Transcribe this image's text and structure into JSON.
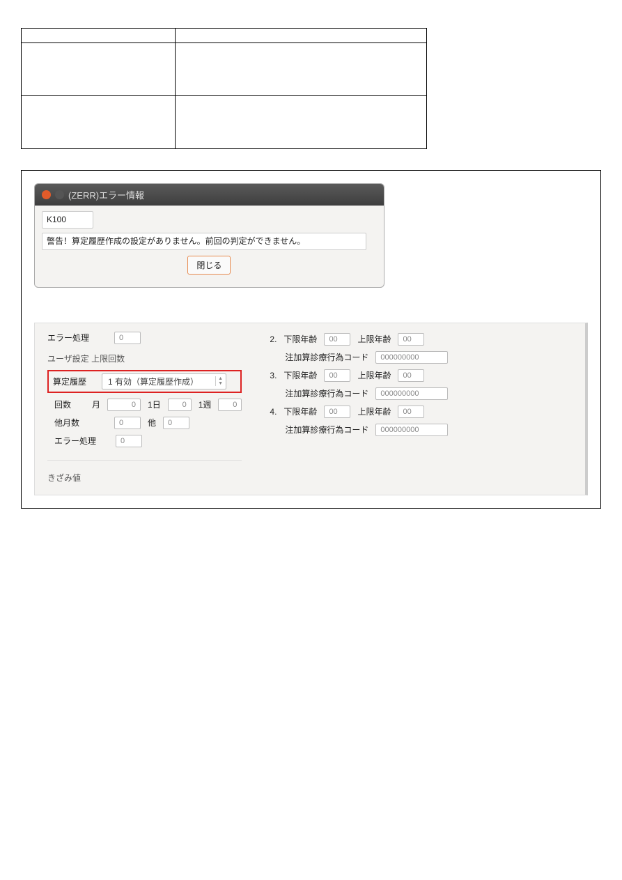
{
  "table": {
    "h1": "",
    "h2": "",
    "r1c1": "",
    "r1c2": "",
    "r2c1": "",
    "r2c2": ""
  },
  "dialog": {
    "title": "(ZERR)エラー情報",
    "code": "K100",
    "message": "警告！算定履歴作成の設定がありません。前回の判定ができません。",
    "close": "閉じる"
  },
  "panel": {
    "left": {
      "err_proc": "エラー処理",
      "err_proc_val": "0",
      "section": "ユーザ設定  上限回数",
      "santei": "算定履歴",
      "santei_val": "1 有効（算定履歴作成）",
      "kaisu": "回数",
      "tsuki": "月",
      "tsuki_v": "0",
      "ichiday": "1日",
      "ichiday_v": "0",
      "ichishuu": "1週",
      "ichishuu_v": "0",
      "tagetsu": "他月数",
      "tagetsu_v": "0",
      "ta": "他",
      "ta_v": "0",
      "err_proc2": "エラー処理",
      "err_proc2_v": "0",
      "kizami": "きざみ値"
    },
    "right": [
      {
        "n": "2",
        "kagen": "下限年齢",
        "kv": "00",
        "jougen": "上限年齢",
        "jv": "00",
        "chuu": "注加算診療行為コード",
        "cv": "000000000"
      },
      {
        "n": "3",
        "kagen": "下限年齢",
        "kv": "00",
        "jougen": "上限年齢",
        "jv": "00",
        "chuu": "注加算診療行為コード",
        "cv": "000000000"
      },
      {
        "n": "4",
        "kagen": "下限年齢",
        "kv": "00",
        "jougen": "上限年齢",
        "jv": "00",
        "chuu": "注加算診療行為コード",
        "cv": "000000000"
      }
    ]
  }
}
